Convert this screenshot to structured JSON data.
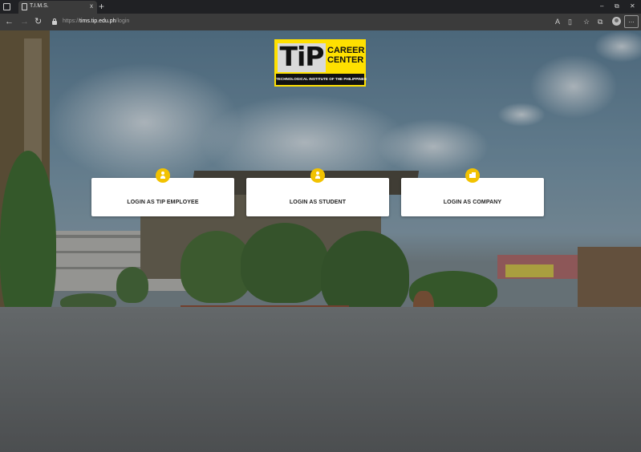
{
  "browser": {
    "tab_title": "T.I.M.S.",
    "tab_close": "x",
    "new_tab": "+",
    "url_prefix": "https://",
    "url_host": "tims.tip.edu.ph",
    "url_path": "/login",
    "window_controls": {
      "minimize": "–",
      "restore": "⧉",
      "close": "✕"
    },
    "nav": {
      "back": "←",
      "forward": "→",
      "reload": "↻"
    },
    "toolbar_icons": {
      "read_aloud": "A",
      "split": "▯",
      "favorites": "☆",
      "collections": "⧉",
      "menu": "…"
    }
  },
  "logo": {
    "mark": "TiP",
    "career": "CAREER",
    "center": "CENTER",
    "tagline": "TECHNOLOGICAL INSTITUTE OF THE PHILIPPINES"
  },
  "login_options": [
    {
      "label": "LOGIN AS TIP EMPLOYEE",
      "icon": "person-icon"
    },
    {
      "label": "LOGIN AS STUDENT",
      "icon": "person-icon"
    },
    {
      "label": "LOGIN AS COMPANY",
      "icon": "building-icon"
    }
  ],
  "colors": {
    "accent": "#f2c200",
    "logo_yellow": "#ffe000",
    "card_background": "#ffffff"
  }
}
